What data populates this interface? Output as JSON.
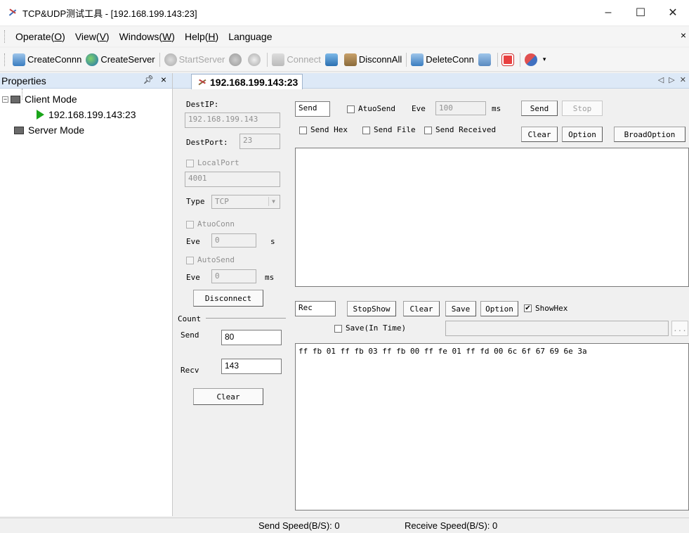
{
  "window": {
    "title": "TCP&UDP测试工具 - [192.168.199.143:23]",
    "minimize": "–",
    "maximize": "☐",
    "close": "✕"
  },
  "menu": {
    "items": [
      {
        "label": "Operate(",
        "key": "O",
        "tail": ")"
      },
      {
        "label": "View(",
        "key": "V",
        "tail": ")"
      },
      {
        "label": "Windows(",
        "key": "W",
        "tail": ")"
      },
      {
        "label": "Help(",
        "key": "H",
        "tail": ")"
      },
      {
        "label": "Language",
        "key": "",
        "tail": ""
      }
    ],
    "close": "×"
  },
  "toolbar": {
    "create_conn": "CreateConnn",
    "create_server": "CreateServer",
    "start_server": "StartServer",
    "connect": "Connect",
    "disconn_all": "DisconnAll",
    "delete_conn": "DeleteConn"
  },
  "properties": {
    "title": "Properties",
    "pin": "ᵖ",
    "close": "×",
    "tree": {
      "client_mode": "Client Mode",
      "client_node": "192.168.199.143:23",
      "server_mode": "Server Mode"
    }
  },
  "doc": {
    "tab_label": "192.168.199.143:23",
    "nav": "◁ ▷ ✕"
  },
  "config": {
    "dest_ip_label": "DestIP:",
    "dest_ip_value": "192.168.199.143",
    "dest_port_label": "DestPort:",
    "dest_port_value": "23",
    "local_port_label": "LocalPort",
    "local_port_value": "4001",
    "type_label": "Type",
    "type_value": "TCP",
    "auto_conn_label": "AtuoConn",
    "eve_label": "Eve",
    "auto_conn_eve_value": "0",
    "auto_conn_unit": "s",
    "auto_send_label": "AutoSend",
    "auto_send_eve_value": "0",
    "auto_send_unit": "ms",
    "disconnect": "Disconnect",
    "count_label": "Count",
    "send_label": "Send",
    "send_count": "80",
    "recv_label": "Recv",
    "recv_count": "143",
    "clear": "Clear"
  },
  "send_panel": {
    "send_tag": "Send",
    "auto_send_label": "AtuoSend",
    "eve_label": "Eve",
    "eve_value": "100",
    "unit": "ms",
    "send_btn": "Send",
    "stop_btn": "Stop",
    "send_hex": "Send Hex",
    "send_file": "Send File",
    "send_received": "Send Received",
    "clear_btn": "Clear",
    "option_btn": "Option",
    "broad_option_btn": "BroadOption",
    "content": ""
  },
  "recv_panel": {
    "rec_tag": "Rec",
    "stop_show_btn": "StopShow",
    "clear_btn": "Clear",
    "save_btn": "Save",
    "option_btn": "Option",
    "show_hex_label": "ShowHex",
    "show_hex_checked": "✔",
    "save_in_time_label": "Save(In Time)",
    "save_path": "",
    "browse_btn": "...",
    "content": "ff fb 01 ff fb 03 ff fb 00 ff fe 01 ff fd 00 6c 6f 67 69 6e 3a"
  },
  "status": {
    "send_speed": "Send Speed(B/S): 0",
    "receive_speed": "Receive Speed(B/S): 0"
  }
}
